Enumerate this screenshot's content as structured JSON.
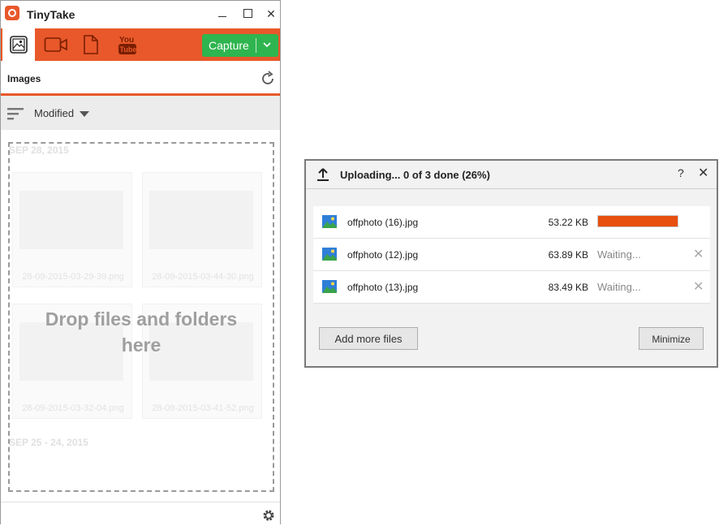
{
  "app": {
    "title": "TinyTake",
    "close_glyph": "✕",
    "toolbar": {
      "capture_label": "Capture",
      "youtube_label": "You Tube"
    },
    "section_title": "Images",
    "sort": {
      "label": "Modified"
    },
    "gallery": {
      "groups": [
        {
          "date": "SEP 28, 2015"
        },
        {
          "date": "SEP 25 - 24, 2015"
        }
      ],
      "thumbnails": [
        "28-09-2015-03-29-39.png",
        "28-09-2015-03-44-30.png",
        "28-09-2015-03-32-04.png",
        "28-09-2015-03-41-52.png"
      ]
    },
    "drop_text": "Drop files and folders here"
  },
  "upload": {
    "title": "Uploading... 0 of 3 done (26%)",
    "help": "?",
    "close": "✕",
    "files": [
      {
        "name": "offphoto (16).jpg",
        "size": "53.22 KB",
        "progress": 1.0
      },
      {
        "name": "offphoto (12).jpg",
        "size": "63.89 KB",
        "status": "Waiting...",
        "remove": "✕"
      },
      {
        "name": "offphoto (13).jpg",
        "size": "83.49 KB",
        "status": "Waiting...",
        "remove": "✕"
      }
    ],
    "add_more_label": "Add more files",
    "minimize_label": "Minimize"
  },
  "colors": {
    "accent": "#e8582a",
    "capture": "#2fb54f",
    "progress": "#e8500f"
  }
}
